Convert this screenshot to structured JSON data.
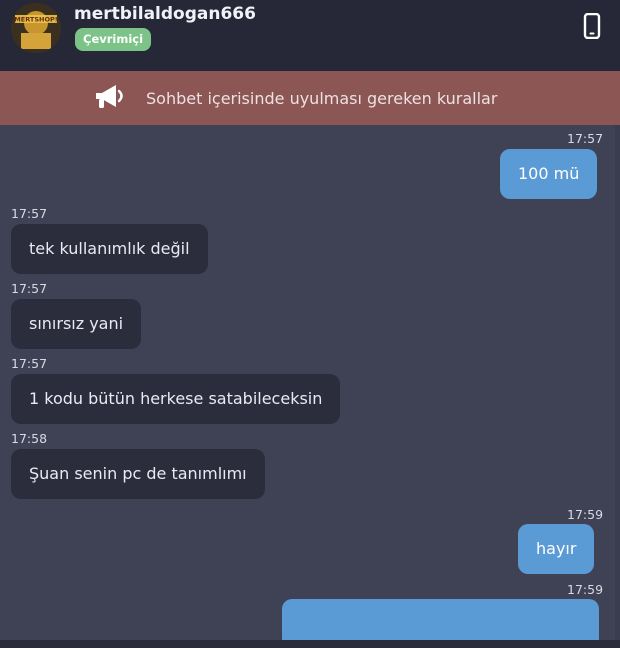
{
  "header": {
    "username": "mertbilaldogan666",
    "status": "Çevrimiçi",
    "avatar_text": "MERTSHOP!",
    "phone_icon": "smartphone-icon"
  },
  "rules_bar": {
    "icon": "megaphone-icon",
    "text": "Sohbet içerisinde uyulması gereken kurallar"
  },
  "messages": [
    {
      "direction": "out",
      "time": "17:57",
      "text": "100 mü"
    },
    {
      "direction": "in",
      "time": "17:57",
      "text": "tek kullanımlık değil"
    },
    {
      "direction": "in",
      "time": "17:57",
      "text": "sınırsız yani"
    },
    {
      "direction": "in",
      "time": "17:57",
      "text": "1 kodu bütün herkese satabileceksin"
    },
    {
      "direction": "in",
      "time": "17:58",
      "text": "Şuan senin pc de tanımlımı"
    },
    {
      "direction": "out",
      "time": "17:59",
      "text": "hayır"
    },
    {
      "direction": "out",
      "time": "17:59",
      "text": ""
    }
  ],
  "colors": {
    "background": "#3f4155",
    "header": "#262838",
    "rules_bar": "#8c5655",
    "incoming_bubble": "#2b2d3d",
    "outgoing_bubble": "#5b9bd5",
    "status_badge": "#7cc388"
  }
}
